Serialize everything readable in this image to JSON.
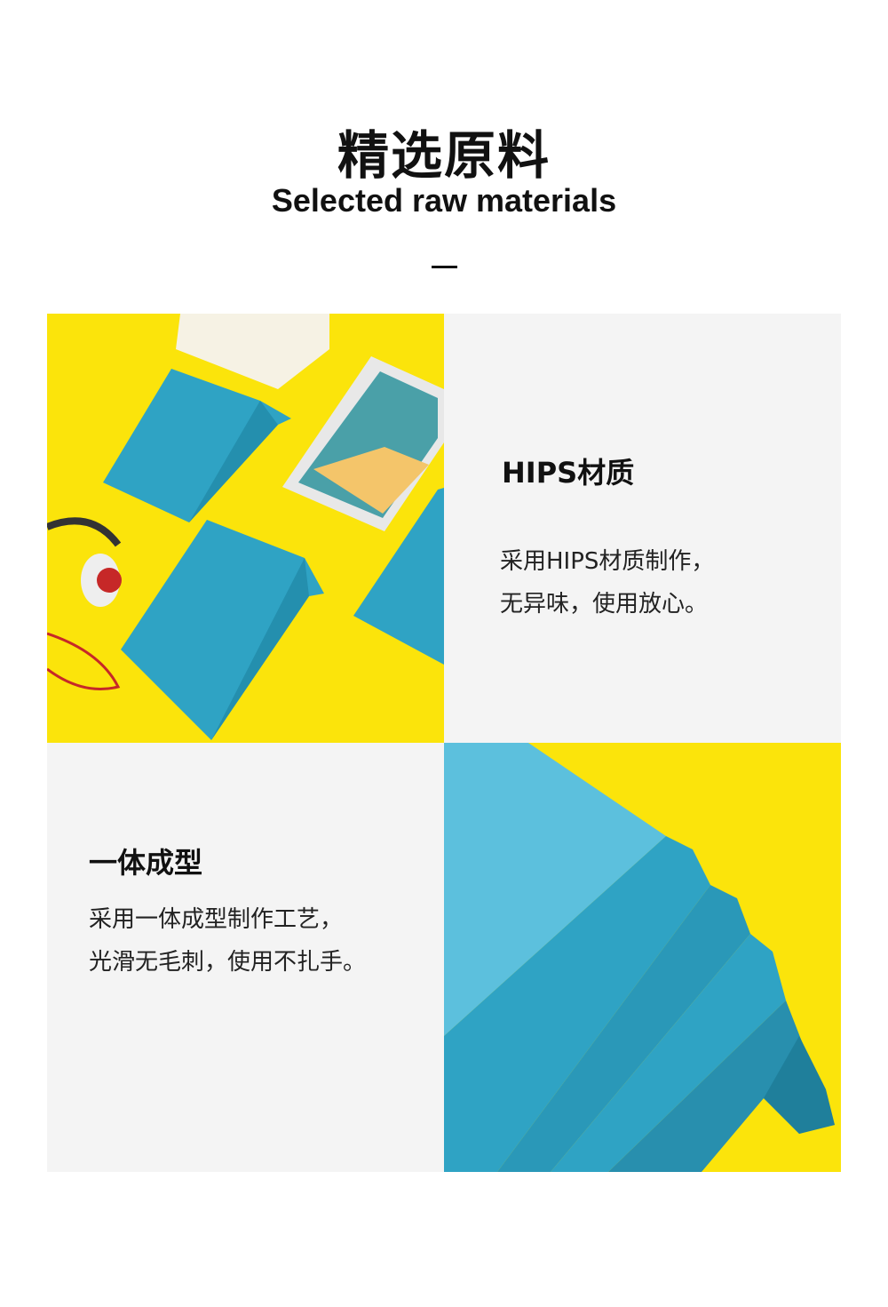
{
  "header": {
    "title": "精选原料",
    "subtitle": "Selected raw materials"
  },
  "features": [
    {
      "heading": "HIPS材质",
      "lines": [
        "采用HIPS材质制作，",
        "无异味，使用放心。"
      ]
    },
    {
      "heading": "一体成型",
      "lines": [
        "采用一体成型制作工艺，",
        "光滑无毛刺，使用不扎手。"
      ]
    }
  ],
  "colors": {
    "yellow": "#fbe40b",
    "teal": "#2fa3c4",
    "panel": "#f4f4f4"
  }
}
